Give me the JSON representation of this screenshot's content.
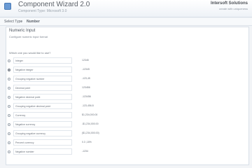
{
  "window": {
    "title": "Component Wizard 2.0",
    "subtitle": "Component Type: Microsoft 3.0",
    "brand": "Intersoft Solutions",
    "brand_tagline": "create with uniqueness"
  },
  "breadcrumb": {
    "items": [
      "Select Type",
      "Number"
    ],
    "separator": "›"
  },
  "panel": {
    "title": "Numeric Input",
    "subtitle": "Configure numeric input format",
    "question": "Which one you would like to use?",
    "options": [
      {
        "label": "Integer",
        "value": "12345",
        "selected": false
      },
      {
        "label": "Negative integer",
        "value": "-12345",
        "selected": true
      },
      {
        "label": "Grouping negative number",
        "value": "-123,45",
        "selected": false
      },
      {
        "label": "Decimal point",
        "value": "123456",
        "selected": false
      },
      {
        "label": "Negative decimal point",
        "value": "-123456",
        "selected": false
      },
      {
        "label": "Grouping negative decimal point",
        "value": "-123,456.8",
        "selected": false
      },
      {
        "label": "Currency",
        "value": "$1,234,000.00",
        "selected": false
      },
      {
        "label": "Negative currency",
        "value": "-$1,234,000.00",
        "selected": false
      },
      {
        "label": "Grouping negative currency",
        "value": "($1,234,000.00)",
        "selected": false
      },
      {
        "label": "Percent currency",
        "value": "0.3 ,18%",
        "selected": false
      },
      {
        "label": "Negative number",
        "value": "-1234",
        "selected": false
      }
    ]
  }
}
